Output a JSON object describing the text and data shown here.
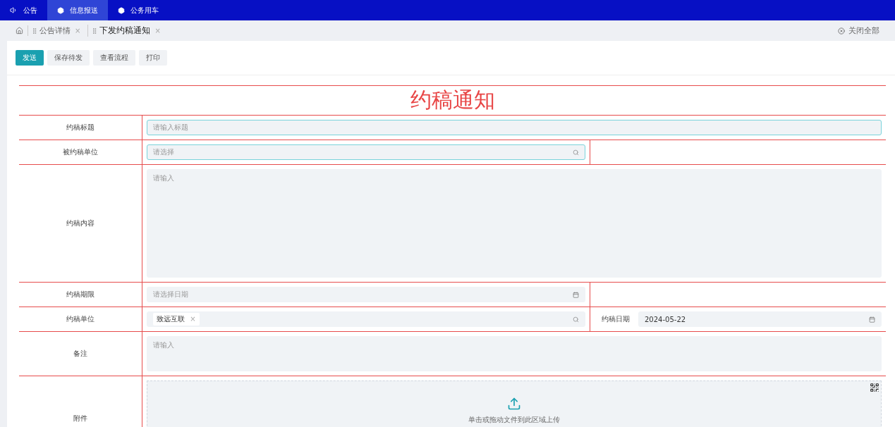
{
  "top_nav": [
    {
      "label": "公告",
      "selected": false
    },
    {
      "label": "信息报送",
      "selected": true
    },
    {
      "label": "公务用车",
      "selected": false
    }
  ],
  "breadcrumb_tabs": [
    {
      "label": "公告详情",
      "close": "×",
      "selected": false
    },
    {
      "label": "下发约稿通知",
      "close": "×",
      "selected": true
    }
  ],
  "close_all": "关闭全部",
  "toolbar": [
    {
      "label": "发送",
      "kind": "primary"
    },
    {
      "label": "保存待发",
      "kind": "plain"
    },
    {
      "label": "查看流程",
      "kind": "plain"
    },
    {
      "label": "打印",
      "kind": "plain"
    }
  ],
  "form": {
    "title": "约稿通知",
    "rows": [
      {
        "label": "约稿标题",
        "kind": "text",
        "placeholder": "请输入标题",
        "focused": true
      },
      {
        "label": "被约稿单位",
        "kind": "select",
        "placeholder": "请选择",
        "focused": true
      },
      {
        "label": "约稿内容",
        "kind": "textarea",
        "placeholder": "请输入",
        "focused": false
      },
      {
        "label": "约稿期限",
        "kind": "date",
        "placeholder": "请选择日期",
        "focused": false
      },
      {
        "label": "约稿单位",
        "kind": "tags",
        "tags": [
          {
            "label": "致远互联",
            "close": "×"
          }
        ],
        "focused": false,
        "extra": {
          "label": "约稿日期",
          "value": "2024-05-22"
        }
      },
      {
        "label": "备注",
        "kind": "note",
        "placeholder": "请输入",
        "focused": false
      },
      {
        "label": "附件",
        "kind": "upload",
        "hint": "单击或拖动文件到此区域上传"
      }
    ]
  }
}
